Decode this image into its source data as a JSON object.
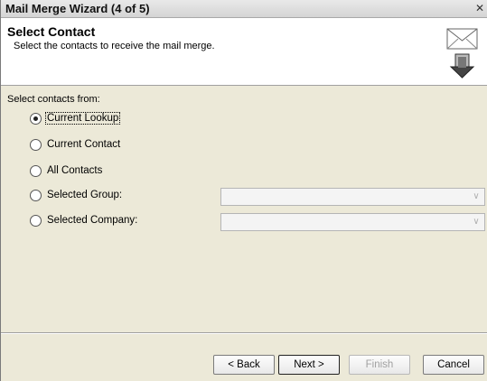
{
  "window": {
    "title": "Mail Merge Wizard (4 of 5)"
  },
  "header": {
    "title": "Select Contact",
    "subtitle": "Select the contacts to receive the mail merge."
  },
  "main": {
    "section_label": "Select contacts from:",
    "options": [
      {
        "label": "Current Lookup",
        "checked": true
      },
      {
        "label": "Current Contact",
        "checked": false
      },
      {
        "label": "All Contacts",
        "checked": false
      },
      {
        "label": "Selected Group:",
        "checked": false
      },
      {
        "label": "Selected Company:",
        "checked": false
      }
    ],
    "group_combo_value": "",
    "company_combo_value": ""
  },
  "buttons": {
    "back": "< Back",
    "next": "Next >",
    "finish": "Finish",
    "cancel": "Cancel"
  }
}
